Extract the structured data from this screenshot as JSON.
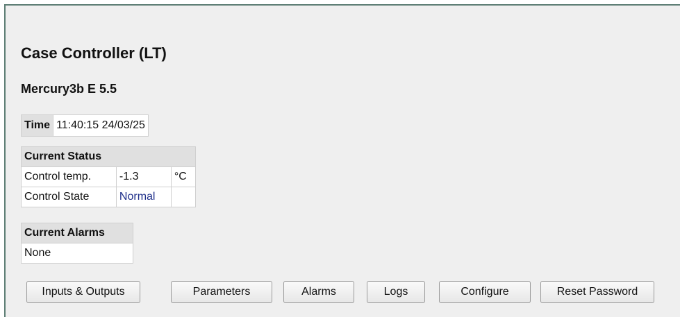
{
  "header": {
    "title": "Case Controller (LT)",
    "subtitle": "Mercury3b E 5.5"
  },
  "time": {
    "label": "Time",
    "value": "11:40:15 24/03/25"
  },
  "current_status": {
    "heading": "Current Status",
    "rows": [
      {
        "label": "Control temp.",
        "value": "-1.3",
        "unit": "°C"
      },
      {
        "label": "Control State",
        "value": "Normal",
        "unit": ""
      }
    ]
  },
  "current_alarms": {
    "heading": "Current Alarms",
    "value": "None"
  },
  "buttons": {
    "inputs_outputs": "Inputs & Outputs",
    "parameters": "Parameters",
    "alarms": "Alarms",
    "logs": "Logs",
    "configure": "Configure",
    "reset_password": "Reset Password"
  },
  "colors": {
    "frame_border": "#5d7d74",
    "background": "#efefef",
    "header_cell": "#e0e0e0",
    "state_normal": "#1f2f8a"
  }
}
